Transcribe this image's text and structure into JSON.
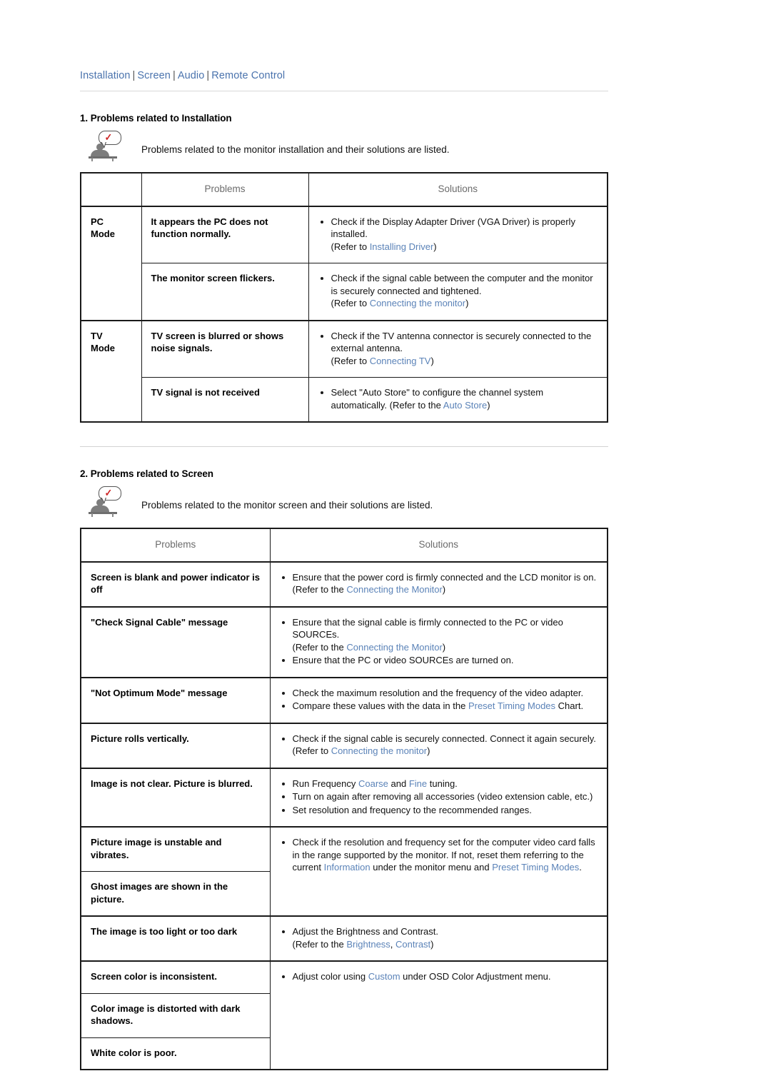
{
  "breadcrumb": {
    "items": [
      "Installation",
      "Screen",
      "Audio",
      "Remote Control"
    ],
    "separator": "|"
  },
  "sections": [
    {
      "title": "1. Problems related to Installation",
      "note": "Problems related to the monitor installation and their solutions are listed.",
      "note_icon": "person-speech-bubble-check-icon",
      "table": {
        "headers": [
          "",
          "Problems",
          "Solutions"
        ],
        "rows": [
          {
            "mode": "PC\nMode",
            "problem": "It appears the PC does not function normally.",
            "solution_runs": [
              [
                {
                  "t": "Check if the Display Adapter Driver (VGA Driver) is properly installed.",
                  "link": false
                },
                {
                  "t": "\n(Refer to ",
                  "link": false
                },
                {
                  "t": "Installing Driver",
                  "link": true
                },
                {
                  "t": ")",
                  "link": false
                }
              ]
            ]
          },
          {
            "problem": "The monitor screen flickers.",
            "solution_runs": [
              [
                {
                  "t": "Check if the signal cable between the computer and the monitor is securely connected and tightened.",
                  "link": false
                },
                {
                  "t": "\n(Refer to ",
                  "link": false
                },
                {
                  "t": "Connecting the monitor",
                  "link": true
                },
                {
                  "t": ")",
                  "link": false
                }
              ]
            ]
          },
          {
            "mode": "TV\nMode",
            "problem": "TV screen is blurred or shows noise signals.",
            "solution_runs": [
              [
                {
                  "t": "Check if the TV antenna connector is securely connected to the external antenna.",
                  "link": false
                },
                {
                  "t": "\n(Refer to ",
                  "link": false
                },
                {
                  "t": "Connecting TV",
                  "link": true
                },
                {
                  "t": ")",
                  "link": false
                }
              ]
            ]
          },
          {
            "problem": "TV signal is not received",
            "solution_runs": [
              [
                {
                  "t": "Select \"Auto Store\" to configure the channel system automatically. (Refer to the ",
                  "link": false
                },
                {
                  "t": "Auto Store",
                  "link": true
                },
                {
                  "t": ")",
                  "link": false
                }
              ]
            ]
          }
        ]
      }
    },
    {
      "title": "2. Problems related to Screen",
      "note": "Problems related to the monitor screen and their solutions are listed.",
      "note_icon": "person-speech-bubble-check-icon",
      "table": {
        "headers": [
          "Problems",
          "Solutions"
        ],
        "rows": [
          {
            "problem": "Screen is blank and power indicator is off",
            "solution_runs": [
              [
                {
                  "t": "Ensure that the power cord is firmly connected and the LCD monitor is on.",
                  "link": false
                },
                {
                  "t": "\n(Refer to the ",
                  "link": false
                },
                {
                  "t": "Connecting the Monitor",
                  "link": true
                },
                {
                  "t": ")",
                  "link": false
                }
              ]
            ]
          },
          {
            "problem": "\"Check Signal Cable\" message",
            "solution_runs": [
              [
                {
                  "t": "Ensure that the signal cable is firmly connected to the PC or video SOURCEs.",
                  "link": false
                },
                {
                  "t": "\n(Refer to the ",
                  "link": false
                },
                {
                  "t": "Connecting the Monitor",
                  "link": true
                },
                {
                  "t": ")",
                  "link": false
                }
              ],
              [
                {
                  "t": "Ensure that the PC or video SOURCEs are turned on.",
                  "link": false
                }
              ]
            ]
          },
          {
            "problem": "\"Not Optimum Mode\" message",
            "solution_runs": [
              [
                {
                  "t": "Check the maximum resolution and the frequency of the video adapter.",
                  "link": false
                }
              ],
              [
                {
                  "t": "Compare these values with the data in the ",
                  "link": false
                },
                {
                  "t": "Preset Timing Modes",
                  "link": true
                },
                {
                  "t": " Chart.",
                  "link": false
                }
              ]
            ]
          },
          {
            "problem": "Picture rolls vertically.",
            "solution_runs": [
              [
                {
                  "t": "Check if the signal cable is securely connected. Connect it again securely.",
                  "link": false
                },
                {
                  "t": "\n(Refer to ",
                  "link": false
                },
                {
                  "t": "Connecting the monitor",
                  "link": true
                },
                {
                  "t": ")",
                  "link": false
                }
              ]
            ]
          },
          {
            "problem": "Image is not clear. Picture is blurred.",
            "solution_runs": [
              [
                {
                  "t": "Run Frequency ",
                  "link": false
                },
                {
                  "t": "Coarse",
                  "link": true
                },
                {
                  "t": " and ",
                  "link": false
                },
                {
                  "t": "Fine",
                  "link": true
                },
                {
                  "t": " tuning.",
                  "link": false
                }
              ],
              [
                {
                  "t": "Turn on again after removing all accessories (video extension cable, etc.)",
                  "link": false
                }
              ],
              [
                {
                  "t": "Set resolution and frequency to the recommended ranges.",
                  "link": false
                }
              ]
            ]
          },
          {
            "problem": "Picture image is unstable and vibrates.",
            "problem2": "Ghost images are shown in the picture.",
            "merged": true,
            "solution_runs": [
              [
                {
                  "t": "Check if the resolution and frequency set for the computer video card falls in the range supported by the monitor. If not, reset them referring to the current ",
                  "link": false
                },
                {
                  "t": "Information",
                  "link": true
                },
                {
                  "t": " under the monitor menu and ",
                  "link": false
                },
                {
                  "t": "Preset Timing Modes",
                  "link": true
                },
                {
                  "t": ".",
                  "link": false
                }
              ]
            ]
          },
          {
            "problem": "The image is too light or too dark",
            "solution_runs": [
              [
                {
                  "t": "Adjust the Brightness and Contrast.",
                  "link": false
                },
                {
                  "t": "\n(Refer to the ",
                  "link": false
                },
                {
                  "t": "Brightness",
                  "link": true
                },
                {
                  "t": ", ",
                  "link": false
                },
                {
                  "t": "Contrast",
                  "link": true
                },
                {
                  "t": ")",
                  "link": false
                }
              ]
            ]
          },
          {
            "problem": "Screen color is inconsistent.",
            "problem2": "Color image is distorted with dark shadows.",
            "problem3": "White color is poor.",
            "merged3": true,
            "solution_runs": [
              [
                {
                  "t": "Adjust color using ",
                  "link": false
                },
                {
                  "t": "Custom",
                  "link": true
                },
                {
                  "t": " under OSD Color Adjustment menu.",
                  "link": false
                }
              ]
            ]
          }
        ]
      }
    }
  ],
  "colors": {
    "link": "#5b83b8",
    "breadcrumb_link": "#4a73ad",
    "table_header_text": "#6b6b6b",
    "border": "#1a1a1a",
    "rule": "#d9d9d9",
    "check_red": "#cc2222",
    "figure_gray": "#7d7d7d"
  }
}
